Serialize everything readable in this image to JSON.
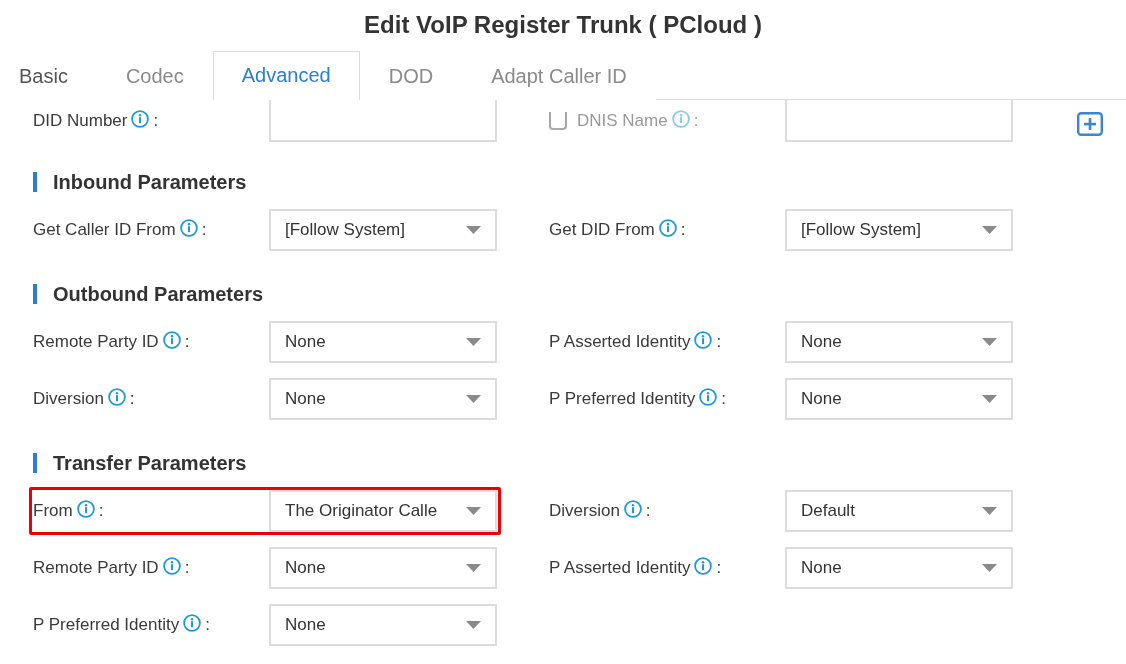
{
  "title": "Edit VoIP Register Trunk ( PCloud )",
  "tabs": [
    {
      "label": "Basic",
      "selected": false
    },
    {
      "label": "Codec",
      "selected": false
    },
    {
      "label": "Advanced",
      "selected": true
    },
    {
      "label": "DOD",
      "selected": false
    },
    {
      "label": "Adapt Caller ID",
      "selected": false
    }
  ],
  "did_row": {
    "did_number": {
      "label": "DID Number",
      "separator": ":"
    },
    "dnis_name": {
      "label": "DNIS Name",
      "separator": ":",
      "checked": false,
      "disabled": true
    }
  },
  "sections": [
    {
      "heading": "Inbound Parameters",
      "fields": [
        {
          "label": "Get Caller ID From",
          "separator": ":",
          "value": "[Follow System]",
          "highlighted": false
        },
        {
          "label": "Get DID From",
          "separator": ":",
          "value": "[Follow System]",
          "highlighted": false
        }
      ]
    },
    {
      "heading": "Outbound Parameters",
      "fields": [
        {
          "label": "Remote Party ID",
          "separator": ":",
          "value": "None",
          "highlighted": false
        },
        {
          "label": "P Asserted Identity",
          "separator": ":",
          "value": "None",
          "highlighted": false
        },
        {
          "label": "Diversion",
          "separator": ":",
          "value": "None",
          "highlighted": false
        },
        {
          "label": "P Preferred Identity",
          "separator": ":",
          "value": "None",
          "highlighted": false
        }
      ]
    },
    {
      "heading": "Transfer Parameters",
      "fields": [
        {
          "label": "From",
          "separator": ":",
          "value": "The Originator Calle",
          "highlighted": true
        },
        {
          "label": "Diversion",
          "separator": ":",
          "value": "Default",
          "highlighted": false
        },
        {
          "label": "Remote Party ID",
          "separator": ":",
          "value": "None",
          "highlighted": false
        },
        {
          "label": "P Asserted Identity",
          "separator": ":",
          "value": "None",
          "highlighted": false
        },
        {
          "label": "P Preferred Identity",
          "separator": ":",
          "value": "None",
          "highlighted": false
        }
      ]
    }
  ]
}
